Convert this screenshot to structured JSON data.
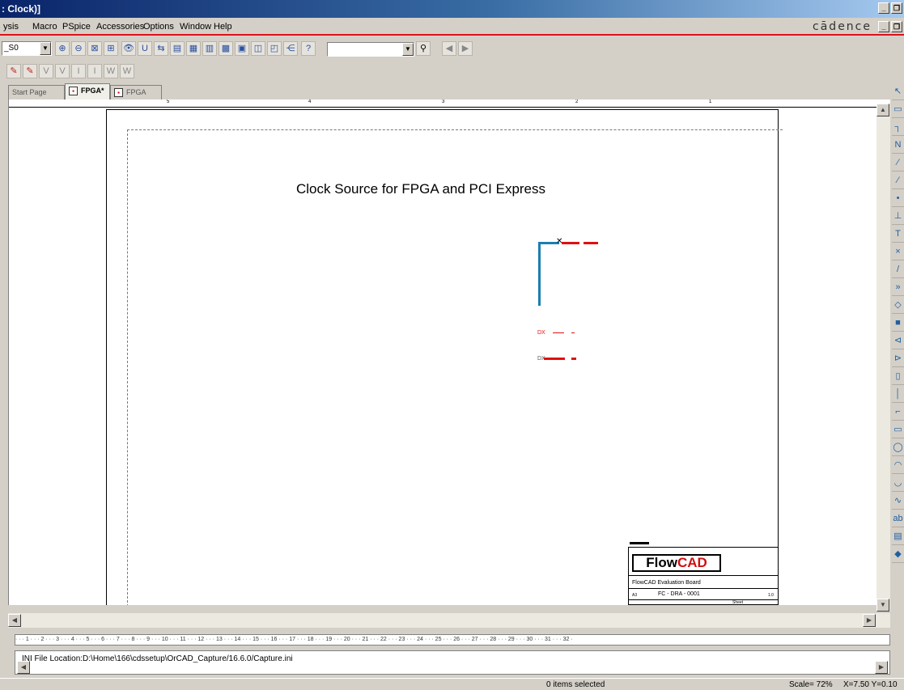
{
  "window": {
    "title": ": Clock)]",
    "min": "_",
    "restore": " ",
    "brand": "cādence"
  },
  "menu": [
    "ysis",
    "Macro",
    "PSpice",
    "Accessories",
    "Options",
    "Window",
    "Help"
  ],
  "toolbar": {
    "part_combo_value": "_S0",
    "search_combo_value": ""
  },
  "tabs": [
    {
      "label": "Start Page"
    },
    {
      "label": "FPGA*"
    },
    {
      "label": "FPGA"
    }
  ],
  "ruler_top": [
    "5",
    "4",
    "3",
    "2",
    "1"
  ],
  "schematic": {
    "title": "Clock Source for FPGA and PCI Express",
    "net1": "DX",
    "net2": "DX"
  },
  "title_block": {
    "logo_flow": "Flow",
    "logo_cad": "CAD",
    "title": "FlowCAD Evaluation Board",
    "doc_number": "FC - DRA - 0001",
    "size": "A3",
    "rev": "1.0",
    "sheet": "Sheet"
  },
  "ruler_bottom": "· · · 1 · · · 2 · · · 3 · · · 4 · · · 5 · · · 6 · · · 7 · · · 8 · · · 9 · · · 10 · · · 11 · · · 12 · · · 13 · · · 14 · · · 15 · · · 16 · · · 17 · · · 18 · · · 19 · · · 20 · · · 21 · · · 22 · · · 23 · · · 24 · · · 25 · · · 26 · · · 27 · · · 28 · · · 29 · · · 30 · · · 31 · · · 32 ·",
  "session_log": "INI File Location:D:\\Home\\166\\cdssetup\\OrCAD_Capture/16.6.0/Capture.ini",
  "status": {
    "selection": "0 items selected",
    "scale": "Scale= 72%",
    "coords": "X=7.50  Y=0.10"
  }
}
